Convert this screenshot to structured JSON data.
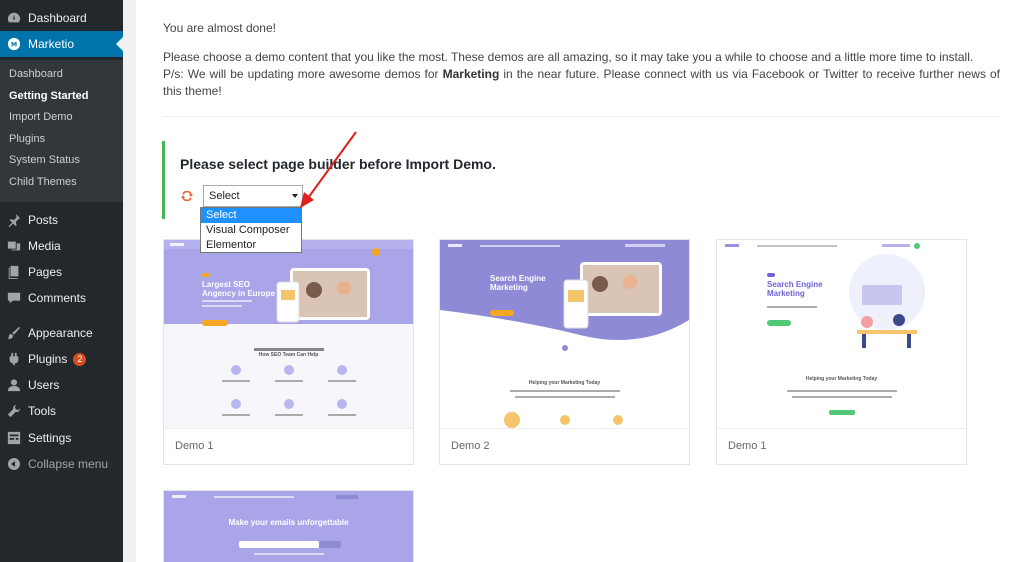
{
  "sidebar": {
    "items": [
      {
        "label": "Dashboard",
        "icon": "dashboard-icon"
      },
      {
        "label": "Marketio",
        "icon": "marketio-logo-icon"
      },
      {
        "label": "Posts",
        "icon": "pin-icon"
      },
      {
        "label": "Media",
        "icon": "media-icon"
      },
      {
        "label": "Pages",
        "icon": "pages-icon"
      },
      {
        "label": "Comments",
        "icon": "comment-icon"
      },
      {
        "label": "Appearance",
        "icon": "brush-icon"
      },
      {
        "label": "Plugins",
        "icon": "plugin-icon",
        "badge": "2"
      },
      {
        "label": "Users",
        "icon": "user-icon"
      },
      {
        "label": "Tools",
        "icon": "wrench-icon"
      },
      {
        "label": "Settings",
        "icon": "settings-icon"
      },
      {
        "label": "Collapse menu",
        "icon": "collapse-icon"
      }
    ],
    "submenu": [
      "Dashboard",
      "Getting Started",
      "Import Demo",
      "Plugins",
      "System Status",
      "Child Themes"
    ],
    "accent": "#0073aa"
  },
  "intro": {
    "line1": "You are almost done!",
    "para_a": "Please choose a demo content that you like the most. These demos are all amazing, so it may take you a while to choose and a little more time to install.",
    "para_b_pre": "P/s: We will be updating more awesome demos for ",
    "para_b_bold": "Marketing",
    "para_b_post": " in the near future. Please connect with us via Facebook or Twitter to receive further news of this theme!"
  },
  "builder": {
    "title": "Please select page builder before Import Demo.",
    "select_value": "Select",
    "options": [
      "Select",
      "Visual Composer",
      "Elementor"
    ]
  },
  "demos": [
    {
      "label": "Demo 1",
      "hero": "Largest SEO Angency in Europe",
      "section": "How SEO Team Can Help"
    },
    {
      "label": "Demo 2",
      "hero": "Search Engine Marketing",
      "section": "Helping your Marketing Today"
    },
    {
      "label": "Demo 1",
      "hero": "Search Engine Marketing",
      "section": "Helping your Marketing Today"
    },
    {
      "label": "",
      "hero": "Make your emails unforgettable",
      "section": ""
    }
  ]
}
